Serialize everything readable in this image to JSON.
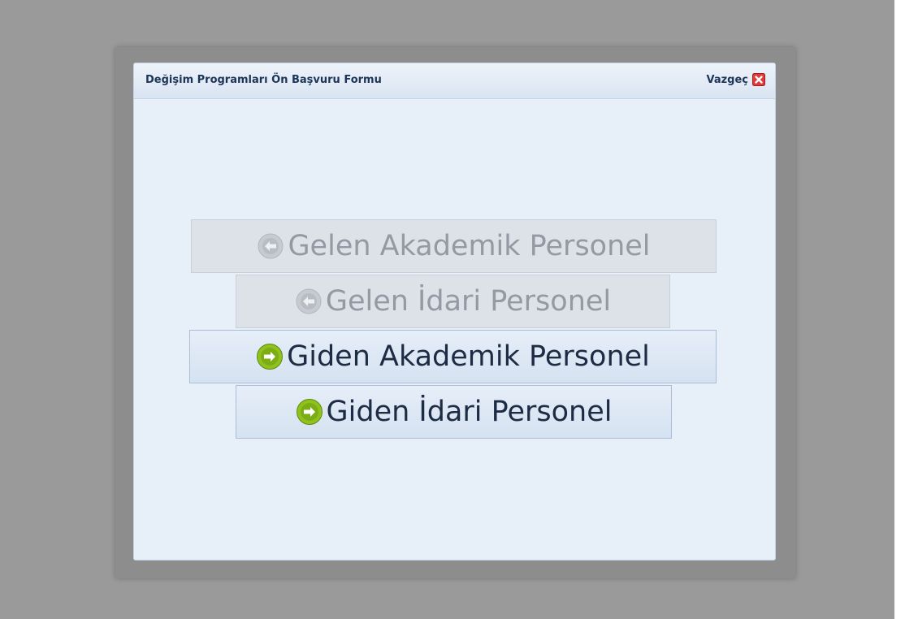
{
  "dialog": {
    "title": "Değişim Programları Ön Başvuru Formu",
    "cancel_label": "Vazgeç"
  },
  "choices": [
    {
      "label": "Gelen Akademik Personel",
      "state": "disabled",
      "icon": "arrow-left-circle-icon"
    },
    {
      "label": "Gelen İdari Personel",
      "state": "disabled",
      "icon": "arrow-left-circle-icon"
    },
    {
      "label": "Giden Akademik Personel",
      "state": "enabled",
      "icon": "arrow-right-circle-icon"
    },
    {
      "label": "Giden İdari Personel",
      "state": "enabled",
      "icon": "arrow-right-circle-icon"
    }
  ],
  "colors": {
    "overlay": "#9a9a9a",
    "dialog_bg": "#e7eff9",
    "enabled_text": "#1d2c44",
    "disabled_text": "#949aa3",
    "enabled_icon": "#8fc21f",
    "cancel_icon": "#e03a3a"
  }
}
